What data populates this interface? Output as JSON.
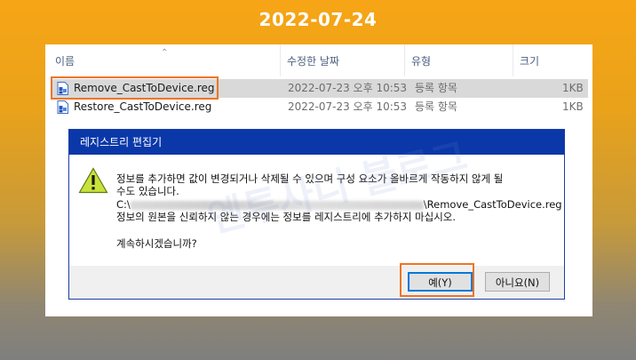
{
  "banner": {
    "date": "2022-07-24"
  },
  "explorer": {
    "columns": [
      "이름",
      "수정한 날짜",
      "유형",
      "크기"
    ],
    "files": [
      {
        "name": "Remove_CastToDevice.reg",
        "modified": "2022-07-23 오후 10:53",
        "type": "등록 항목",
        "size": "1KB"
      },
      {
        "name": "Restore_CastToDevice.reg",
        "modified": "2022-07-23 오후 10:53",
        "type": "등록 항목",
        "size": "1KB"
      }
    ]
  },
  "dialog": {
    "title": "레지스트리 편집기",
    "line1": "정보를 추가하면 값이 변경되거나 삭제될 수 있으며 구성 요소가 올바르게 작동하지 않게 될",
    "line2": "수도 있습니다.",
    "path_prefix": "C:\\",
    "path_suffix": "\\Remove_CastToDevice.reg",
    "line4": "정보의 원본을 신뢰하지 않는 경우에는 정보를 레지스트리에 추가하지 마십시오.",
    "question": "계속하시겠습니까?",
    "yes_label": "예(Y)",
    "no_label": "아니요(N)"
  },
  "watermark": {
    "text": "엔투사니 블로그"
  },
  "colors": {
    "highlight": "#ee7423",
    "title_bar": "#0a38a8",
    "focus": "#0078d7"
  }
}
